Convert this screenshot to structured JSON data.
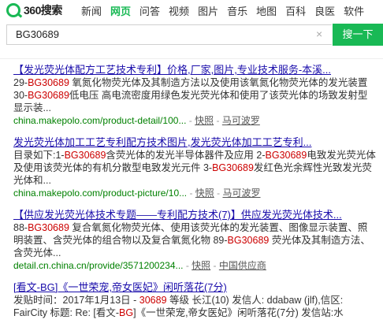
{
  "logo_text": "360搜索",
  "nav": [
    "新闻",
    "网页",
    "问答",
    "视频",
    "图片",
    "音乐",
    "地图",
    "百科",
    "良医",
    "软件"
  ],
  "nav_active": "网页",
  "search": {
    "value": "BG30689",
    "button": "搜一下",
    "clear": "×"
  },
  "results": [
    {
      "title": "【发光荧光体配方工艺技术专利】价格,厂家,图片,专业技术服务-本溪...",
      "body": [
        {
          "t": "29-"
        },
        {
          "t": "BG30689",
          "h": true
        },
        {
          "t": " 氧氮化物荧光体及其制造方法以及使用该氧氮化物荧光体的发光装置 30-"
        },
        {
          "t": "BG30689",
          "h": true
        },
        {
          "t": "低电压 高电流密度用绿色发光荧光体和使用了该荧光体的场致发射型显示装..."
        }
      ],
      "url": "china.makepolo.com/product-detail/100...",
      "links": [
        "快照",
        "马可波罗"
      ]
    },
    {
      "title": "发光荧光体加工工艺专利配方技术图片,发光荧光体加工工艺专利...",
      "body": [
        {
          "t": "目录如下:1-"
        },
        {
          "t": "BG30689",
          "h": true
        },
        {
          "t": "含荧光体的发光半导体器件及应用 2-"
        },
        {
          "t": "BG30689",
          "h": true
        },
        {
          "t": "电致发光荧光体及使用该荧光体的有机分散型电致发光元件 3-"
        },
        {
          "t": "BG30689",
          "h": true
        },
        {
          "t": "发红色光余辉性光致发光荧光体和..."
        }
      ],
      "url": "china.makepolo.com/product-picture/10...",
      "links": [
        "快照",
        "马可波罗"
      ]
    },
    {
      "title": "【供应发光荧光体技术专题——专利配方技术(7)】供应发光荧光体技术...",
      "body": [
        {
          "t": "88-"
        },
        {
          "t": "BG30689",
          "h": true
        },
        {
          "t": " 复合氧氮化物荧光体、使用该荧光体的发光装置、图像显示装置、照明装置、含荧光体的组合物以及复合氧氮化物 89-"
        },
        {
          "t": "BG30689",
          "h": true
        },
        {
          "t": " 荧光体及其制造方法、含荧光体..."
        }
      ],
      "url": "detail.cn.china.cn/provide/3571200234...",
      "links": [
        "快照",
        "中国供应商"
      ]
    },
    {
      "title": "[看文-BG]《一世荣宠,帝女医妃》闲听落花(7分)",
      "title_hl": true,
      "body": [
        {
          "t": "发贴时间：2017年1月13日 - "
        },
        {
          "t": "30689",
          "h": true
        },
        {
          "t": " 等级 长江(10) 发信人: ddabaw (jlf),信区: FairCity 标题: Re: [看文-"
        },
        {
          "t": "BG",
          "h": true
        },
        {
          "t": "]《一世荣宠,帝女医妃》闲听落花(7分) 发信站:水"
        }
      ],
      "url": "",
      "links": []
    }
  ]
}
